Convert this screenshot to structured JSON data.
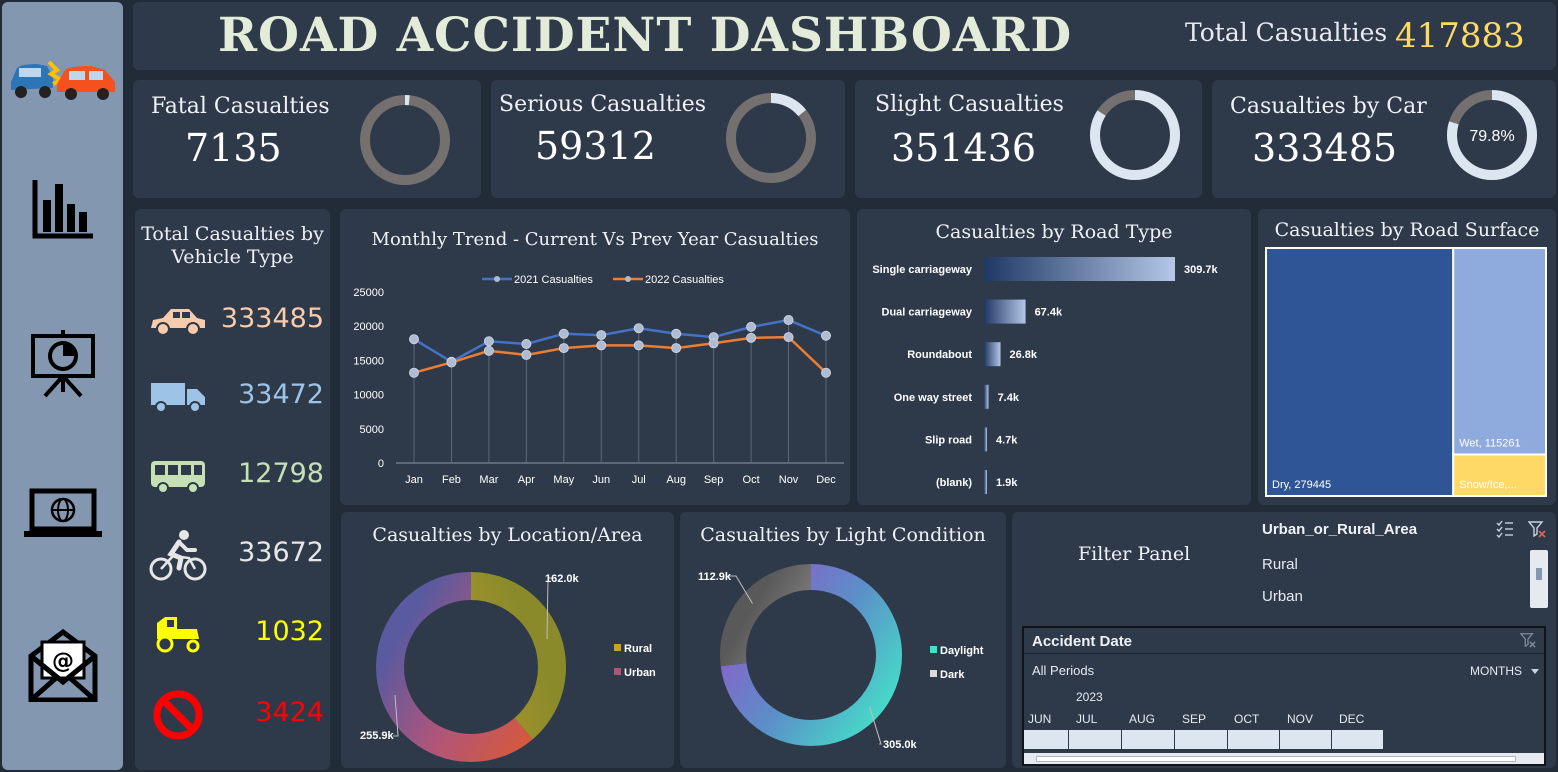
{
  "header": {
    "title": "ROAD ACCIDENT DASHBOARD",
    "total_label": "Total Casualties",
    "total_value": "417883"
  },
  "sidebar": {
    "items": [
      "accident-cars-icon",
      "bar-chart-icon",
      "presentation-icon",
      "laptop-globe-icon",
      "email-icon"
    ]
  },
  "kpis": [
    {
      "label": "Fatal Casualties",
      "value": "7135",
      "share": 0.017
    },
    {
      "label": "Serious Casualties",
      "value": "59312",
      "share": 0.142
    },
    {
      "label": "Slight Casualties",
      "value": "351436",
      "share": 0.841
    },
    {
      "label": "Casualties by Car",
      "value": "333485",
      "share": 0.798,
      "share_label": "79.8%"
    }
  ],
  "vehicle": {
    "title_line1": "Total Casualties by",
    "title_line2": "Vehicle Type",
    "items": [
      {
        "icon": "car-icon",
        "value": "333485",
        "color": "#f8cbad"
      },
      {
        "icon": "truck-icon",
        "value": "33472",
        "color": "#9dc3e6"
      },
      {
        "icon": "bus-icon",
        "value": "12798",
        "color": "#c5e0b4"
      },
      {
        "icon": "bicycle-icon",
        "value": "33672",
        "color": "#e7e6e6"
      },
      {
        "icon": "tractor-icon",
        "value": "1032",
        "color": "#ffff00"
      },
      {
        "icon": "no-entry-icon",
        "value": "3424",
        "color": "#ff0000"
      }
    ]
  },
  "colors": {
    "line_2021": "#4472c4",
    "line_2022": "#ed7d31",
    "ring_track": "#747070",
    "ring_highlight": "#dce6f1",
    "dry": "#2f5597",
    "wet": "#8faadc",
    "snow": "#ffd966"
  },
  "chart_data": [
    {
      "type": "line",
      "title": "Monthly Trend - Current Vs Prev Year Casualties",
      "categories": [
        "Jan",
        "Feb",
        "Mar",
        "Apr",
        "May",
        "Jun",
        "Jul",
        "Aug",
        "Sep",
        "Oct",
        "Nov",
        "Dec"
      ],
      "series": [
        {
          "name": "2021 Casualties",
          "values": [
            18100,
            14800,
            17800,
            17400,
            18900,
            18700,
            19700,
            18900,
            18400,
            19900,
            20900,
            18600
          ]
        },
        {
          "name": "2022 Casualties",
          "values": [
            13200,
            14700,
            16400,
            15800,
            16800,
            17200,
            17200,
            16800,
            17500,
            18300,
            18400,
            13200
          ]
        }
      ],
      "yticks": [
        "0",
        "5000",
        "10000",
        "15000",
        "20000",
        "25000"
      ],
      "ylim": [
        0,
        25000
      ],
      "legend": "top"
    },
    {
      "type": "bar",
      "orientation": "horizontal",
      "title": "Casualties by Road Type",
      "categories": [
        "Single carriageway",
        "Dual carriageway",
        "Roundabout",
        "One way street",
        "Slip road",
        "(blank)"
      ],
      "values": [
        309700,
        67400,
        26800,
        7400,
        4700,
        1900
      ],
      "labels": [
        "309.7k",
        "67.4k",
        "26.8k",
        "7.4k",
        "4.7k",
        "1.9k"
      ]
    },
    {
      "type": "heatmap",
      "title": "Casualties by Road Surface",
      "items": [
        {
          "label": "Dry, 279445",
          "value": 279445
        },
        {
          "label": "Wet, 115261",
          "value": 115261
        },
        {
          "label": "Snow/Ice,...",
          "value": 23177
        }
      ]
    },
    {
      "type": "pie",
      "title": "Casualties by Location/Area",
      "categories": [
        "Rural",
        "Urban"
      ],
      "values": [
        162000,
        255900
      ],
      "labels": [
        "162.0k",
        "255.9k"
      ],
      "legend": "right"
    },
    {
      "type": "pie",
      "title": "Casualties by Light Condition",
      "categories": [
        "Daylight",
        "Dark"
      ],
      "values": [
        305000,
        112900
      ],
      "labels": [
        "305.0k",
        "112.9k"
      ],
      "legend": "right"
    }
  ],
  "filter": {
    "title": "Filter Panel",
    "slicer_title": "Urban_or_Rural_Area",
    "slicer_items": [
      "Rural",
      "Urban"
    ],
    "timeline_title": "Accident Date",
    "timeline_period": "All Periods",
    "timeline_unit": "MONTHS",
    "timeline_year": "2023",
    "timeline_months": [
      "JUN",
      "JUL",
      "AUG",
      "SEP",
      "OCT",
      "NOV",
      "DEC"
    ]
  }
}
